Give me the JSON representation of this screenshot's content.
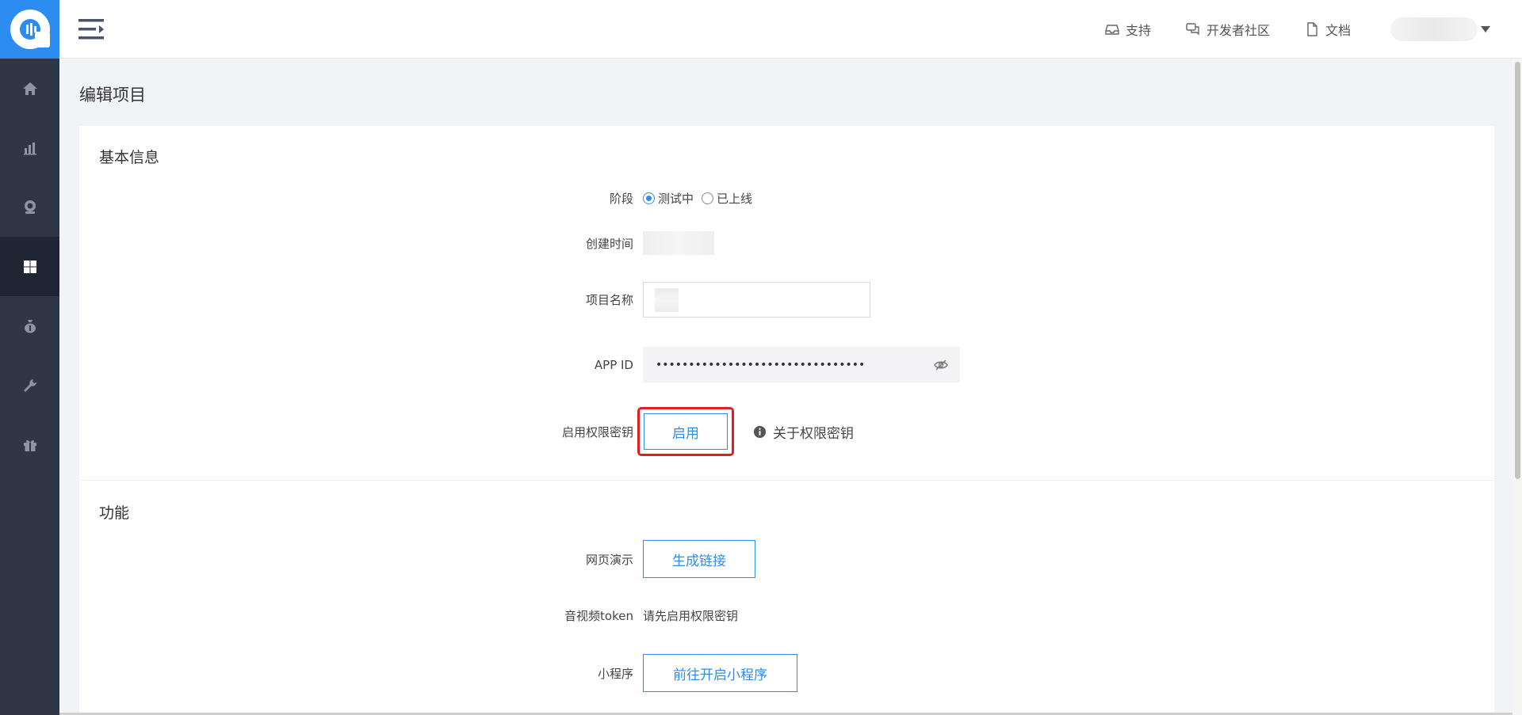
{
  "header": {
    "links": [
      {
        "icon": "support-icon",
        "label": "支持"
      },
      {
        "icon": "community-icon",
        "label": "开发者社区"
      },
      {
        "icon": "document-icon",
        "label": "文档"
      }
    ]
  },
  "page": {
    "title": "编辑项目"
  },
  "basic": {
    "section_title": "基本信息",
    "stage": {
      "label": "阶段",
      "options": [
        "测试中",
        "已上线"
      ],
      "selected": "测试中"
    },
    "created_time": {
      "label": "创建时间"
    },
    "project_name": {
      "label": "项目名称"
    },
    "app_id": {
      "label": "APP ID",
      "value": "••••••••••••••••••••••••••••••••"
    },
    "permission_key": {
      "label": "启用权限密钥",
      "button": "启用",
      "about": "关于权限密钥"
    }
  },
  "features": {
    "section_title": "功能",
    "web_demo": {
      "label": "网页演示",
      "button": "生成链接"
    },
    "av_token": {
      "label": "音视频token",
      "value": "请先启用权限密钥"
    },
    "mini_program": {
      "label": "小程序",
      "button": "前往开启小程序"
    }
  },
  "colors": {
    "accent": "#2d8cf0",
    "sidebar": "#2f3747",
    "highlight": "#e02020"
  }
}
